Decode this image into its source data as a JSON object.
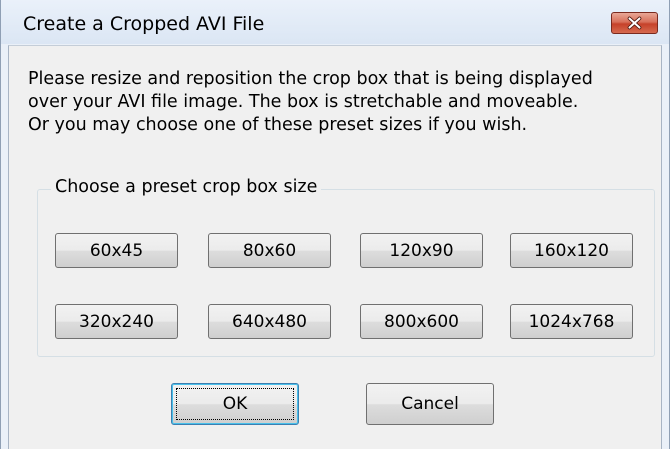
{
  "window": {
    "title": "Create a Cropped AVI File"
  },
  "message": {
    "line1": "Please resize and reposition the crop box that is being displayed",
    "line2": "over your AVI file image.  The box is stretchable and moveable.",
    "line3": "Or you may choose one of these preset sizes if you wish."
  },
  "presets": {
    "legend": "Choose a preset crop box size",
    "sizes": [
      "60x45",
      "80x60",
      "120x90",
      "160x120",
      "320x240",
      "640x480",
      "800x600",
      "1024x768"
    ]
  },
  "buttons": {
    "ok": "OK",
    "cancel": "Cancel"
  },
  "icons": {
    "close": "close-icon"
  },
  "colors": {
    "close_button": "#c6412a",
    "dialog_background": "#f0f0f0",
    "titlebar": "#dbe6f4"
  }
}
